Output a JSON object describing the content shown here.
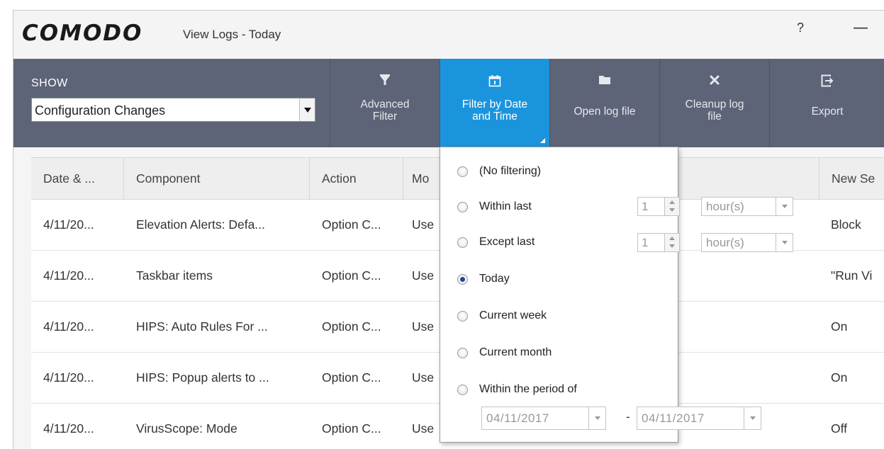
{
  "window": {
    "brand": "COMODO",
    "title": "View Logs - Today",
    "help_label": "?",
    "minimize_label": "—"
  },
  "toolbar": {
    "show_label": "SHOW",
    "show_select_value": "Configuration Changes",
    "buttons": [
      {
        "id": "advanced-filter",
        "icon": "funnel-icon",
        "line1": "Advanced",
        "line2": "Filter"
      },
      {
        "id": "filter-by-date",
        "icon": "calendar-icon",
        "line1": "Filter by Date",
        "line2": "and Time",
        "active": true
      },
      {
        "id": "open-log-file",
        "icon": "folder-icon",
        "line1": "Open log file",
        "line2": ""
      },
      {
        "id": "cleanup-log-file",
        "icon": "close-x-icon",
        "line1": "Cleanup log",
        "line2": "file"
      },
      {
        "id": "export",
        "icon": "export-icon",
        "line1": "Export",
        "line2": ""
      }
    ],
    "colors": {
      "toolbar_bg": "#5d6477",
      "active_bg": "#1a95dd"
    }
  },
  "table": {
    "columns": [
      "Date & ...",
      "Component",
      "Action",
      "Mo",
      "New Se"
    ],
    "rows": [
      [
        "4/11/20...",
        "Elevation Alerts: Defa...",
        "Option C...",
        "Use",
        "Block"
      ],
      [
        "4/11/20...",
        "Taskbar items",
        "Option C...",
        "Use",
        "\"Run Vi"
      ],
      [
        "4/11/20...",
        "HIPS: Auto Rules For ...",
        "Option C...",
        "Use",
        "On"
      ],
      [
        "4/11/20...",
        "HIPS: Popup alerts to ...",
        "Option C...",
        "Use",
        "On"
      ],
      [
        "4/11/20...",
        "VirusScope: Mode",
        "Option C...",
        "Use",
        "Off"
      ]
    ]
  },
  "filter_popup": {
    "options": [
      {
        "label": "(No filtering)",
        "checked": false
      },
      {
        "label": "Within last",
        "checked": false
      },
      {
        "label": "Except last",
        "checked": false
      },
      {
        "label": "Today",
        "checked": true
      },
      {
        "label": "Current week",
        "checked": false
      },
      {
        "label": "Current month",
        "checked": false
      },
      {
        "label": "Within the period of",
        "checked": false
      }
    ],
    "within_last": {
      "value": "1",
      "unit": "hour(s)"
    },
    "except_last": {
      "value": "1",
      "unit": "hour(s)"
    },
    "period": {
      "from": "04/11/2017",
      "separator": "-",
      "to": "04/11/2017"
    }
  }
}
